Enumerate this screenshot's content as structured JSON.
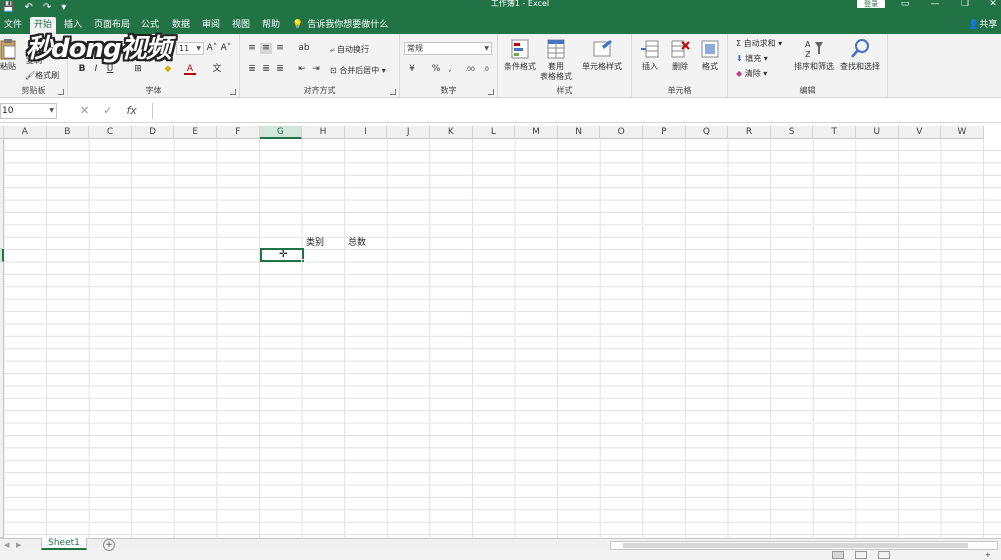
{
  "titlebar": {
    "title": "工作簿1 - Excel",
    "login": "登录",
    "qat_save": "💾",
    "qat_undo": "↶",
    "qat_redo": "↷",
    "qat_more": "▾",
    "ribbon_options": "▭",
    "minimize": "—",
    "restore": "❐",
    "close": "✕"
  },
  "tabs": [
    "文件",
    "开始",
    "插入",
    "页面布局",
    "公式",
    "数据",
    "审阅",
    "视图",
    "帮助"
  ],
  "tell_me": "告诉我你想要做什么",
  "share": "共享",
  "logo_text": "秒dong视频",
  "ribbon": {
    "clipboard": {
      "label": "剪贴板",
      "paste": "粘贴",
      "copy": "复制",
      "format_painter": "格式刷"
    },
    "font": {
      "label": "字体",
      "size": "11",
      "grow": "A˄",
      "shrink": "A˅",
      "bold": "B",
      "italic": "I",
      "underline": "U",
      "border": "⊞",
      "fill": "◆",
      "font_color": "A",
      "phonetic": "文"
    },
    "alignment": {
      "label": "对齐方式",
      "wrap_text": "自动换行",
      "merge_center": "合并后居中"
    },
    "number": {
      "label": "数字",
      "format": "常规",
      "currency": "¥",
      "percent": "%",
      "comma": ",",
      "inc_decimal": ".00",
      "dec_decimal": ".0"
    },
    "styles": {
      "label": "样式",
      "conditional": "条件格式",
      "table_format_1": "套用",
      "table_format_2": "表格格式",
      "cell_styles": "单元格样式"
    },
    "cells": {
      "label": "单元格",
      "insert": "插入",
      "delete": "删除",
      "format": "格式"
    },
    "editing": {
      "label": "编辑",
      "autosum": "自动求和",
      "fill": "填充",
      "clear": "清除",
      "sort_filter": "排序和筛选",
      "find_select": "查找和选择"
    }
  },
  "formula_bar": {
    "name_box": "10",
    "cancel": "✕",
    "enter": "✓",
    "fx": "fx",
    "value": ""
  },
  "grid": {
    "columns": [
      "A",
      "B",
      "C",
      "D",
      "E",
      "F",
      "G",
      "H",
      "I",
      "J",
      "K",
      "L",
      "M",
      "N",
      "O",
      "P",
      "Q",
      "R",
      "S",
      "T",
      "U",
      "V",
      "W"
    ],
    "selected_column": "G",
    "cells": [
      {
        "text": "类别"
      },
      {
        "text": "总数"
      }
    ]
  },
  "sheets": [
    "Sheet1"
  ],
  "add_sheet": "+",
  "status": {
    "zoom": "+ 100%"
  }
}
